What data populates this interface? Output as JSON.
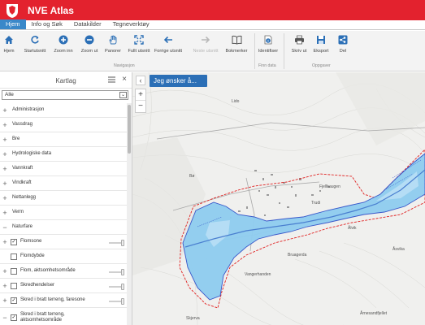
{
  "app": {
    "title": "NVE Atlas"
  },
  "tabs": [
    {
      "label": "Hjem",
      "active": true
    },
    {
      "label": "Info og Søk"
    },
    {
      "label": "Datakilder"
    },
    {
      "label": "Tegneverktøy"
    }
  ],
  "ribbon": {
    "buttons": [
      {
        "label": "Hjem",
        "icon": "home-icon"
      },
      {
        "label": "Startutsnitt",
        "icon": "refresh-icon"
      },
      {
        "label": "Zoom inn",
        "icon": "zoom-in-icon"
      },
      {
        "label": "Zoom ut",
        "icon": "zoom-out-icon"
      },
      {
        "label": "Panorer",
        "icon": "hand-icon"
      },
      {
        "label": "Fullt utsnitt",
        "icon": "full-extent-icon"
      },
      {
        "label": "Forrige utsnitt",
        "icon": "arrow-left-icon"
      },
      {
        "label": "Neste utsnitt",
        "icon": "arrow-right-icon",
        "disabled": true
      },
      {
        "label": "Bokmerker",
        "icon": "book-icon"
      },
      {
        "label": "Identifiser",
        "icon": "info-icon"
      },
      {
        "label": "Skriv ut",
        "icon": "print-icon"
      },
      {
        "label": "Eksport",
        "icon": "export-icon"
      },
      {
        "label": "Del",
        "icon": "share-icon"
      }
    ],
    "groups": {
      "navigation": "Navigasjon",
      "finn_data": "Finn data",
      "oppgaver": "Oppgaver"
    }
  },
  "sidebar": {
    "title": "Kartlag",
    "filter": "Alle",
    "layers": [
      {
        "label": "Administrasjon",
        "expander": "+"
      },
      {
        "label": "Vassdrag",
        "expander": "+"
      },
      {
        "label": "Bre",
        "expander": "+"
      },
      {
        "label": "Hydrologiske data",
        "expander": "+"
      },
      {
        "label": "Vannkraft",
        "expander": "+"
      },
      {
        "label": "Vindkraft",
        "expander": "+"
      },
      {
        "label": "Nettanlegg",
        "expander": "+"
      },
      {
        "label": "Verm",
        "expander": "+"
      },
      {
        "label": "Naturfare",
        "expander": "−"
      },
      {
        "label": "Flomsone",
        "expander": "+",
        "checked": true,
        "opacity": 1
      },
      {
        "label": "Flomdybde",
        "expander": "",
        "checked": false
      },
      {
        "label": "Flom, aktsomhetsområde",
        "expander": "+",
        "checked": false,
        "opacity": 1
      },
      {
        "label": "Skredhendelser",
        "expander": "+",
        "checked": false,
        "opacity": 1
      },
      {
        "label": "Skred i bratt terreng, faresone",
        "expander": "+",
        "checked": true,
        "opacity": 1
      },
      {
        "label": "Skred i bratt terreng, aktsomhetsområde",
        "expander": "−",
        "checked": true
      }
    ]
  },
  "map": {
    "search_button": "Jeg ønsker å...",
    "collapse": "‹",
    "zoom_in": "+",
    "zoom_out": "−",
    "labels": [
      "Lido",
      "Ålvik",
      "Bruagerda",
      "Åsvika",
      "Vangerhanden",
      "Årnesandfjellet",
      "Skjerva",
      "Fjellhaugen",
      "Bø",
      "Trudi"
    ],
    "colors": {
      "flood_fill": "#8fcdf0",
      "flood_border": "#2f50c9",
      "hazard_border": "#e02020",
      "terrain": "#f0f0ee"
    }
  }
}
